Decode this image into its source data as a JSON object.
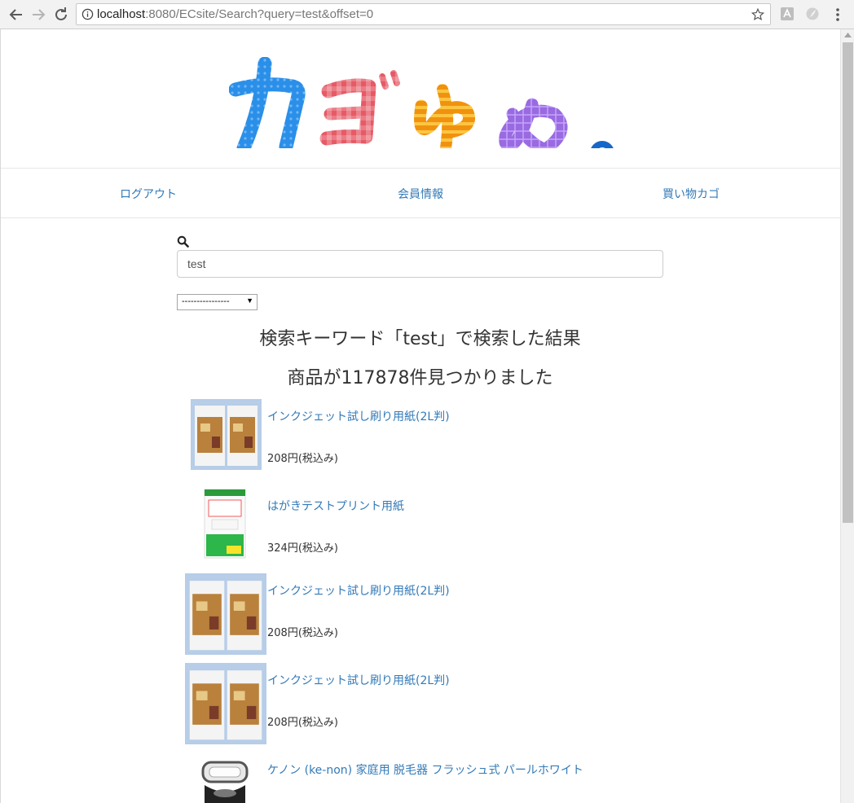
{
  "browser": {
    "url_host": "localhost",
    "url_rest": ":8080/ECsite/Search?query=test&offset=0"
  },
  "site": {
    "logo_chars": [
      "カ",
      "ゴ",
      "ゆ",
      "め",
      "。"
    ],
    "logo_colors": [
      "#2a8fe8",
      "#e65a66",
      "#f0920f",
      "#9a6ae0",
      "#1667c9"
    ]
  },
  "nav": {
    "logout": "ログアウト",
    "member_info": "会員情報",
    "cart": "買い物カゴ"
  },
  "search": {
    "query": "test",
    "sort_selected": "----------------"
  },
  "results": {
    "heading": "検索キーワード「test」で検索した結果",
    "count_text": "商品が117878件見つかりました"
  },
  "items": [
    {
      "name": "インクジェット試し刷り用紙(2L判)",
      "price": "208円(税込み)",
      "image": "inkjet-paper"
    },
    {
      "name": "はがきテストプリント用紙",
      "price": "324円(税込み)",
      "image": "postcard-paper"
    },
    {
      "name": "インクジェット試し刷り用紙(2L判)",
      "price": "208円(税込み)",
      "image": "inkjet-paper"
    },
    {
      "name": "インクジェット試し刷り用紙(2L判)",
      "price": "208円(税込み)",
      "image": "inkjet-paper"
    },
    {
      "name": "ケノン (ke-non) 家庭用 脱毛器 フラッシュ式 パールホワイト",
      "price": "",
      "image": "hair-removal-device"
    }
  ]
}
